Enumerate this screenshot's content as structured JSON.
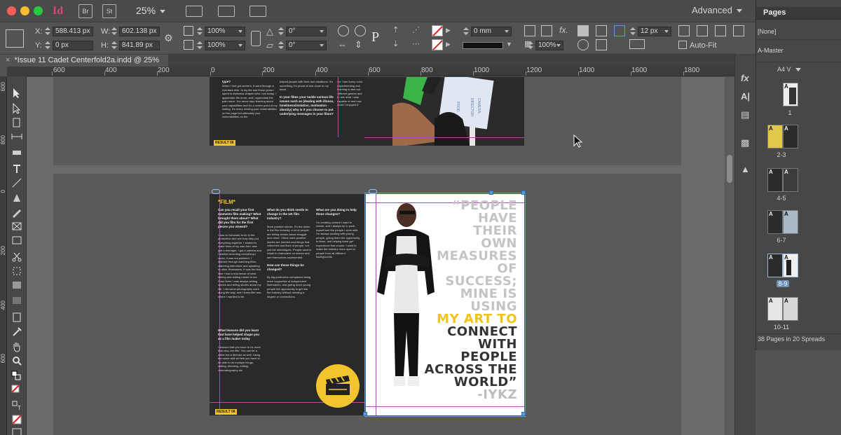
{
  "app": {
    "logo": "Id",
    "bridge_label": "Br",
    "stock_label": "St",
    "zoom": "25%",
    "workspace": "Advanced"
  },
  "control": {
    "x_label": "X:",
    "x_value": "588.413 px",
    "y_label": "Y:",
    "y_value": "0 px",
    "w_label": "W:",
    "w_value": "602.138 px",
    "h_label": "H:",
    "h_value": "841.89 px",
    "scale_x": "100%",
    "scale_y": "100%",
    "rotate": "0°",
    "shear": "0°",
    "stroke_weight": "0 mm",
    "opacity": "100%",
    "offset": "12 px",
    "autofit_label": "Auto-Fit"
  },
  "document": {
    "tab_title": "*Issue 11 Cadet Centerfold2a.indd @ 25%"
  },
  "ruler": {
    "labels": [
      "600",
      "400",
      "200",
      "0",
      "200",
      "400",
      "600",
      "800",
      "1000",
      "1200",
      "1400",
      "1600",
      "1800"
    ],
    "vlabels": [
      "600",
      "800",
      "0",
      "200",
      "400",
      "600"
    ]
  },
  "spread": {
    "film_title": "*FILM*",
    "col1_heading": "Can you recall your first moments film making? What brought them about? What did you film for the first pieces you viewed?",
    "col2_heading": "What do you think needs to change in the UK film industry?",
    "col3_heading": "What are you doing to help these changes?",
    "col4_heading": "How can these things be changed?",
    "col5_heading": "What lessons did you learn that have helped shape you as a film maker today",
    "quote_lines": [
      "“PEOPLE",
      "HAVE",
      "THEIR",
      "OWN",
      "MEASURES",
      "OF",
      "SUCCESS;",
      "MINE IS",
      "USING",
      "MY ART TO",
      "CONNECT",
      "WITH",
      "PEOPLE",
      "ACROSS THE",
      "WORLD”",
      "-IYKZ"
    ],
    "badge_text": "RESULT 08",
    "badge_text_top": "RESULT 06"
  },
  "pages_panel": {
    "title": "Pages",
    "none_label": "[None]",
    "master_label": "A-Master",
    "size_label": "A4 V",
    "page_labels": [
      "1",
      "2-3",
      "4-5",
      "6-7",
      "8-9",
      "10-11"
    ],
    "footer": "38 Pages in 20 Spreads"
  }
}
